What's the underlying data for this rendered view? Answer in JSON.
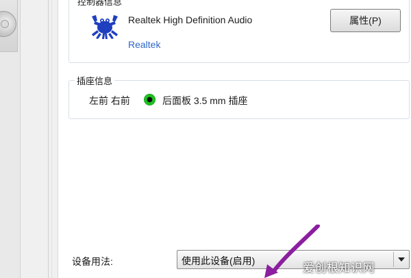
{
  "driver": {
    "section_title": "控制器信息",
    "name": "Realtek High Definition Audio",
    "vendor": "Realtek",
    "properties_button": "属性(P)",
    "logo_icon": "realtek-crab-logo"
  },
  "jack": {
    "section_title": "插座信息",
    "position": "左前 右前",
    "indicator_color": "#1fbf1f",
    "description": "后面板 3.5 mm 插座"
  },
  "usage": {
    "label": "设备用法:",
    "selected": "使用此设备(启用)"
  },
  "watermark": {
    "text": "爱创根知识网"
  },
  "colors": {
    "vendor_link": "#2f67c8",
    "arrow": "#8b1fa0"
  }
}
